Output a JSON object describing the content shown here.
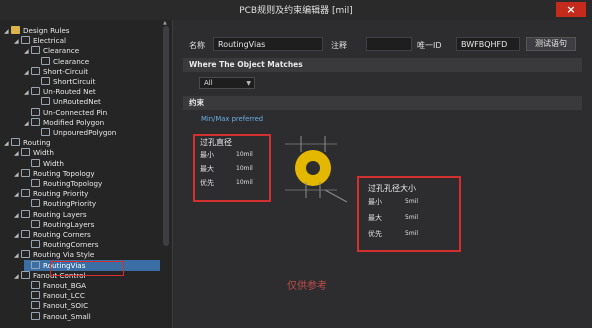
{
  "window": {
    "title": "PCB规则及约束编辑器 [mil]",
    "close_label": "×"
  },
  "tree": {
    "items": [
      {
        "label": "Design Rules",
        "tri": "◢",
        "icon": "folder"
      },
      {
        "label": "Electrical",
        "tri": "◢",
        "icon": "rule"
      },
      {
        "label": "Clearance",
        "tri": "◢",
        "icon": "rule"
      },
      {
        "label": "Clearance",
        "tri": "",
        "icon": "rule"
      },
      {
        "label": "Short-Circuit",
        "tri": "◢",
        "icon": "rule"
      },
      {
        "label": "ShortCircuit",
        "tri": "",
        "icon": "rule"
      },
      {
        "label": "Un-Routed Net",
        "tri": "◢",
        "icon": "rule"
      },
      {
        "label": "UnRoutedNet",
        "tri": "",
        "icon": "rule"
      },
      {
        "label": "Un-Connected Pin",
        "tri": "",
        "icon": "rule"
      },
      {
        "label": "Modified Polygon",
        "tri": "◢",
        "icon": "rule"
      },
      {
        "label": "UnpouredPolygon",
        "tri": "",
        "icon": "rule"
      },
      {
        "label": "Routing",
        "tri": "◢",
        "icon": "rule"
      },
      {
        "label": "Width",
        "tri": "◢",
        "icon": "rule"
      },
      {
        "label": "Width",
        "tri": "",
        "icon": "rule"
      },
      {
        "label": "Routing Topology",
        "tri": "◢",
        "icon": "rule"
      },
      {
        "label": "RoutingTopology",
        "tri": "",
        "icon": "rule"
      },
      {
        "label": "Routing Priority",
        "tri": "◢",
        "icon": "rule"
      },
      {
        "label": "RoutingPriority",
        "tri": "",
        "icon": "rule"
      },
      {
        "label": "Routing Layers",
        "tri": "◢",
        "icon": "rule"
      },
      {
        "label": "RoutingLayers",
        "tri": "",
        "icon": "rule"
      },
      {
        "label": "Routing Corners",
        "tri": "◢",
        "icon": "rule"
      },
      {
        "label": "RoutingCorners",
        "tri": "",
        "icon": "rule"
      },
      {
        "label": "Routing Via Style",
        "tri": "◢",
        "icon": "rule"
      },
      {
        "label": "RoutingVias",
        "tri": "",
        "icon": "rule",
        "selected": true
      },
      {
        "label": "Fanout Control",
        "tri": "◢",
        "icon": "rule"
      },
      {
        "label": "Fanout_BGA",
        "tri": "",
        "icon": "rule"
      },
      {
        "label": "Fanout_LCC",
        "tri": "",
        "icon": "rule"
      },
      {
        "label": "Fanout_SOIC",
        "tri": "",
        "icon": "rule"
      },
      {
        "label": "Fanout_Small",
        "tri": "",
        "icon": "rule"
      }
    ]
  },
  "form": {
    "name_label": "名称",
    "name_value": "RoutingVias",
    "comment_label": "注释",
    "comment_value": "",
    "uid_label": "唯一ID",
    "uid_value": "BWFBQHFD",
    "test_button": "测试语句",
    "where_header": "Where The Object Matches",
    "match_value": "All",
    "constraint_header": "约束",
    "minmax_label": "Min/Max preferred"
  },
  "via_diameter": {
    "title": "过孔直径",
    "rows": [
      {
        "label": "最小",
        "value": "10mil"
      },
      {
        "label": "最大",
        "value": "10mil"
      },
      {
        "label": "优先",
        "value": "10mil"
      }
    ]
  },
  "hole_size": {
    "title": "过孔孔径大小",
    "rows": [
      {
        "label": "最小",
        "value": "5mil"
      },
      {
        "label": "最大",
        "value": "5mil"
      },
      {
        "label": "优先",
        "value": "5mil"
      }
    ]
  },
  "watermark": "仅供参考",
  "colors": {
    "accent_red": "#d32f2f",
    "selection": "#3b6ea5",
    "via_ring": "#e5b800"
  }
}
